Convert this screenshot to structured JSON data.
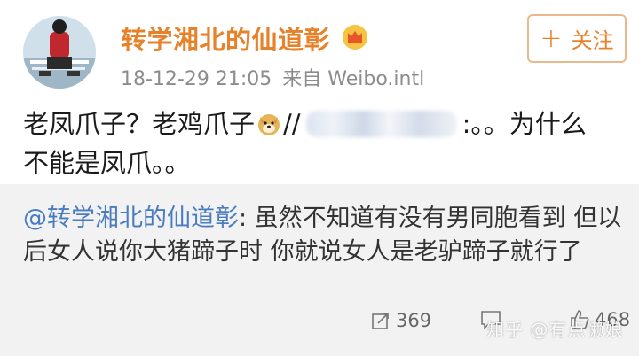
{
  "post": {
    "username": "转学湘北的仙道彰",
    "timestamp": "18-12-29 21:05",
    "source": "来自 Weibo.intl",
    "follow_label": "关注",
    "text_line1_start": "老凤爪子？老鸡爪子",
    "text_line1_slashes": "//",
    "text_line1_end": ":。。为什么",
    "text_line2": "不能是凤爪。。"
  },
  "repost": {
    "mention": "@转学湘北的仙道彰",
    "text": ": 虽然不知道有没有男同胞看到 但以后女人说你大猪蹄子时 你就说女人是老驴蹄子就行了"
  },
  "actions": {
    "repost_count": "369",
    "like_count": "468"
  },
  "watermark": "知乎 @有点懒娘",
  "colors": {
    "username": "#e7812a",
    "mention": "#4a7cc0",
    "repost_bg": "#f2f2f2"
  }
}
